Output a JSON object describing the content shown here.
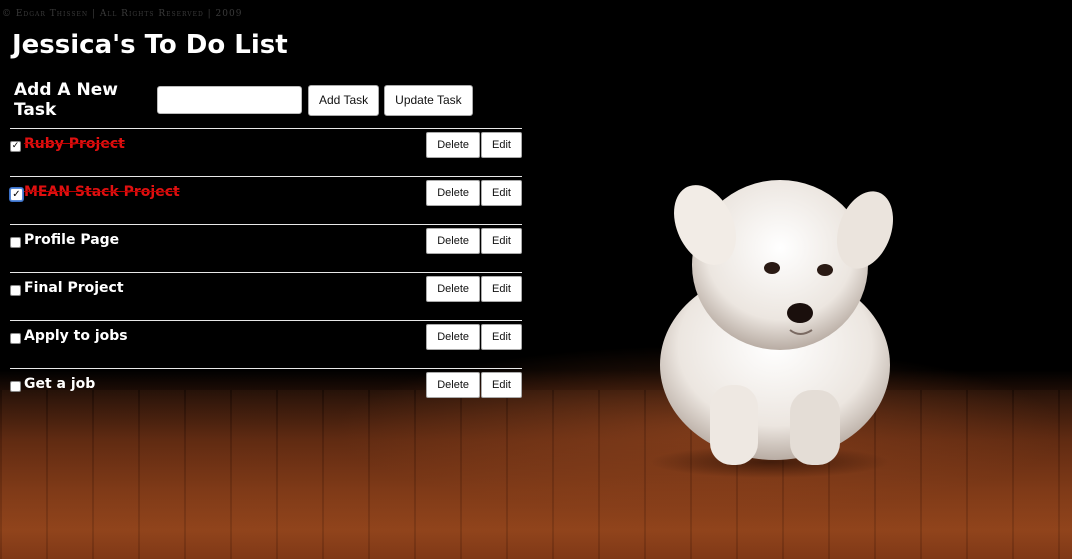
{
  "watermark": "© Edgar Thissen | All Rights Reserved | 2009",
  "page_title": "Jessica's To Do List",
  "add_form": {
    "label": "Add A New Task",
    "input_value": "",
    "add_button": "Add Task",
    "update_button": "Update Task"
  },
  "tasks": [
    {
      "name": "Ruby Project",
      "checked": true,
      "delete_label": "Delete",
      "edit_label": "Edit"
    },
    {
      "name": "MEAN Stack Project",
      "checked": true,
      "delete_label": "Delete",
      "edit_label": "Edit"
    },
    {
      "name": "Profile Page",
      "checked": false,
      "delete_label": "Delete",
      "edit_label": "Edit"
    },
    {
      "name": "Final Project",
      "checked": false,
      "delete_label": "Delete",
      "edit_label": "Edit"
    },
    {
      "name": "Apply to jobs",
      "checked": false,
      "delete_label": "Delete",
      "edit_label": "Edit"
    },
    {
      "name": "Get a job",
      "checked": false,
      "delete_label": "Delete",
      "edit_label": "Edit"
    }
  ],
  "colors": {
    "background": "#000000",
    "completed_text": "#e01010",
    "text": "#ffffff",
    "floor": "#7a3615"
  }
}
